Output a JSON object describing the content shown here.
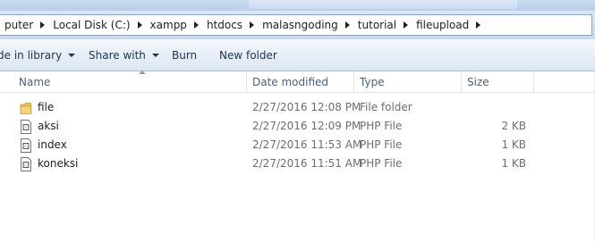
{
  "window": {
    "title_ghost": ""
  },
  "address_bar": {
    "crumbs": [
      "puter",
      "Local Disk (C:)",
      "xampp",
      "htdocs",
      "malasngoding",
      "tutorial",
      "fileupload"
    ]
  },
  "toolbar": {
    "include_in_library_label": "de in library",
    "share_with_label": "Share with",
    "burn_label": "Burn",
    "new_folder_label": "New folder"
  },
  "columns": {
    "name": "Name",
    "date_modified": "Date modified",
    "type": "Type",
    "size": "Size"
  },
  "files": [
    {
      "name": "file",
      "date": "2/27/2016 12:08 PM",
      "type": "File folder",
      "size": "",
      "icon": "folder-icon"
    },
    {
      "name": "aksi",
      "date": "2/27/2016 12:09 PM",
      "type": "PHP File",
      "size": "2 KB",
      "icon": "php-file-icon"
    },
    {
      "name": "index",
      "date": "2/27/2016 11:53 AM",
      "type": "PHP File",
      "size": "1 KB",
      "icon": "php-file-icon"
    },
    {
      "name": "koneksi",
      "date": "2/27/2016 11:51 AM",
      "type": "PHP File",
      "size": "1 KB",
      "icon": "php-file-icon"
    }
  ],
  "colors": {
    "folder": "#e8c260",
    "header_text": "#4c607a",
    "toolbar_text": "#1e3350"
  }
}
